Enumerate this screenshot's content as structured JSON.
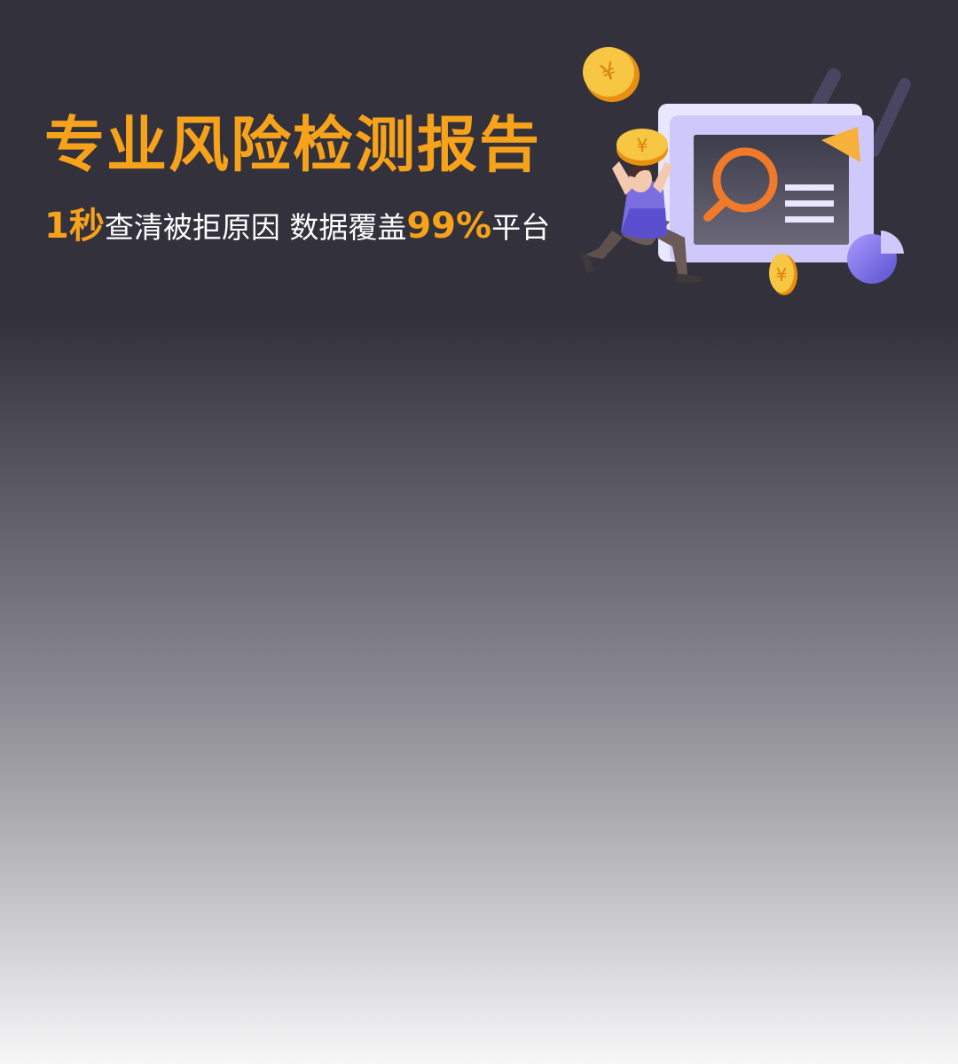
{
  "banner": {
    "title": "专业风险检测报告",
    "subtitle": {
      "part1_highlight": "1秒",
      "part2": "查清被拒原因 数据覆盖",
      "part3_highlight": "99%",
      "part4": "平台"
    },
    "coin_symbol": "¥"
  },
  "colors": {
    "accent": "#f7a21b",
    "background_top": "#32313c",
    "background_bottom": "#f7f7f8",
    "illustration_purple": "#7b6ee0",
    "magnifier_orange": "#f07a2a"
  },
  "icons": [
    "coin-icon",
    "magnifier-icon",
    "pie-chart-icon",
    "document-lines-icon",
    "play-triangle-icon",
    "person-figure"
  ]
}
